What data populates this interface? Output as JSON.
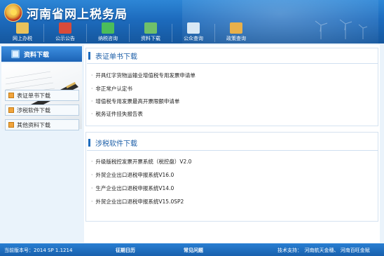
{
  "header": {
    "title": "河南省网上税务局"
  },
  "nav": [
    {
      "label": "网上办税",
      "icon": "hands-icon",
      "color": "#e9c25b"
    },
    {
      "label": "公示公告",
      "icon": "person-podium-icon",
      "color": "#d94b3a"
    },
    {
      "label": "纳税咨询",
      "icon": "people-group-icon",
      "color": "#4bbd5a"
    },
    {
      "label": "资料下载",
      "icon": "download-folder-icon",
      "color": "#6fc06a"
    },
    {
      "label": "公众查询",
      "icon": "search-document-icon",
      "color": "#d8e8f5"
    },
    {
      "label": "政策查询",
      "icon": "folder-icon",
      "color": "#e8b04a"
    }
  ],
  "sidebar": {
    "title": "资料下载",
    "items": [
      {
        "label": "表证单书下载"
      },
      {
        "label": "涉税软件下载"
      },
      {
        "label": "其他资料下载"
      }
    ]
  },
  "sections": [
    {
      "title": "表证单书下载",
      "links": [
        "开具红字货物运输业增值税专用发票申请单",
        "非正常户认定书",
        "增值税专用发票最高开票限额申请单",
        "税务证件挂失报告表"
      ]
    },
    {
      "title": "涉税软件下载",
      "links": [
        "升级版税控发票开票系统（税控盘）V2.0",
        "外贸企业出口退税申报系统V16.0",
        "生产企业出口退税申报系统V14.0",
        "外贸企业出口退税申报系统V15.0SP2"
      ]
    }
  ],
  "footer": {
    "version": "当前版本号：2014 SP 1.1214",
    "link1": "征期日历",
    "link2": "常见问题",
    "support": "技术支持：　河南航天金穗、 河南百旺金赋"
  }
}
